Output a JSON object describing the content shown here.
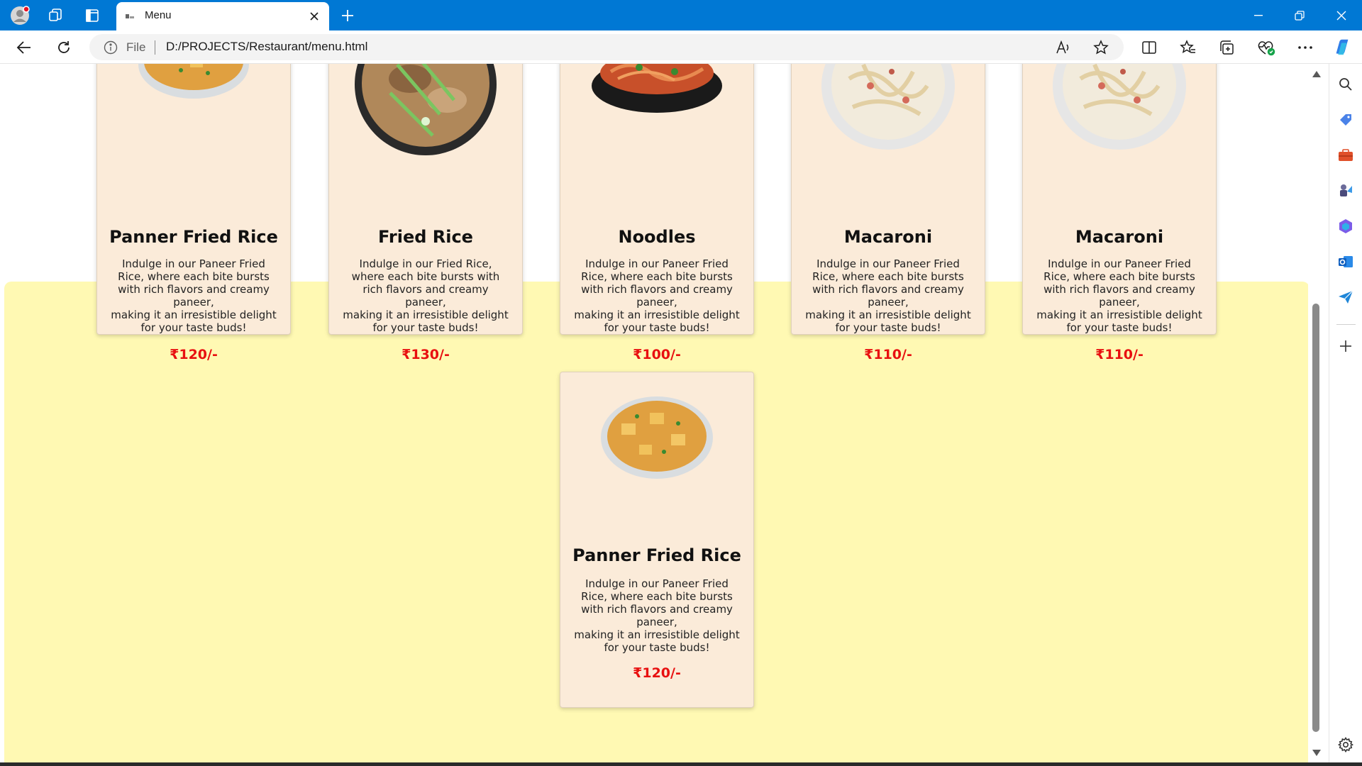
{
  "browser": {
    "tab_title": "Menu",
    "file_label": "File",
    "url": "D:/PROJECTS/Restaurant/menu.html"
  },
  "icons": {
    "profile": "profile-icon",
    "workspaces": "workspaces-icon",
    "tab_actions": "tab-actions-icon",
    "back": "back-arrow-icon",
    "refresh": "refresh-icon",
    "info": "info-icon",
    "read_aloud": "read-aloud-icon",
    "favorite": "star-icon",
    "split": "split-screen-icon",
    "favorites": "favorites-icon",
    "collections": "collections-icon",
    "browser_essentials": "heart-pulse-icon",
    "more": "more-icon",
    "copilot": "copilot-icon"
  },
  "menu": {
    "items": [
      {
        "name": "Panner Fried Rice",
        "desc_lines": [
          "Indulge in our Paneer Fried",
          "Rice, where each bite bursts",
          "with rich flavors and creamy",
          "paneer,",
          "making it an irresistible delight",
          "for your taste buds!"
        ],
        "price": "₹120/-",
        "dish": "paneer-rice"
      },
      {
        "name": "Fried Rice",
        "desc_lines": [
          "Indulge in our Fried Rice,",
          "where each bite bursts with",
          "rich flavors and creamy",
          "paneer,",
          "making it an irresistible delight",
          "for your taste buds!"
        ],
        "price": "₹130/-",
        "dish": "fried-rice"
      },
      {
        "name": "Noodles",
        "desc_lines": [
          "Indulge in our Paneer Fried",
          "Rice, where each bite bursts",
          "with rich flavors and creamy",
          "paneer,",
          "making it an irresistible delight",
          "for your taste buds!"
        ],
        "price": "₹100/-",
        "dish": "noodles"
      },
      {
        "name": "Macaroni",
        "desc_lines": [
          "Indulge in our Paneer Fried",
          "Rice, where each bite bursts",
          "with rich flavors and creamy",
          "paneer,",
          "making it an irresistible delight",
          "for your taste buds!"
        ],
        "price": "₹110/-",
        "dish": "macaroni"
      },
      {
        "name": "Macaroni",
        "desc_lines": [
          "Indulge in our Paneer Fried",
          "Rice, where each bite bursts",
          "with rich flavors and creamy",
          "paneer,",
          "making it an irresistible delight",
          "for your taste buds!"
        ],
        "price": "₹110/-",
        "dish": "macaroni"
      },
      {
        "name": "Panner Fried Rice",
        "desc_lines": [
          "Indulge in our Paneer Fried",
          "Rice, where each bite bursts",
          "with rich flavors and creamy",
          "paneer,",
          "making it an irresistible delight",
          "for your taste buds!"
        ],
        "price": "₹120/-",
        "dish": "paneer-rice"
      }
    ]
  },
  "colors": {
    "titlebar": "#0078d4",
    "card_bg": "#fbebd9",
    "section_bg": "#fff9b3",
    "price": "#e81010"
  }
}
